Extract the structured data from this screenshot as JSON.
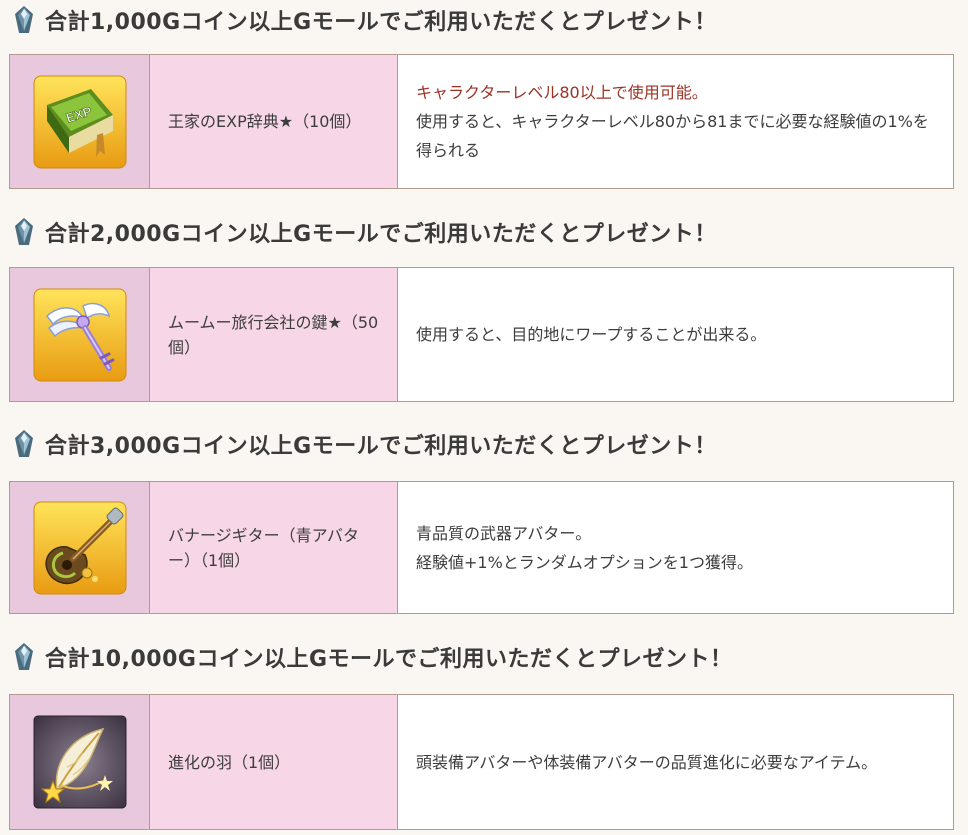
{
  "sections": [
    {
      "heading": "合計1,000Gコイン以上Gモールでご利用いただくとプレゼント！",
      "item_name": "王家のEXP辞典★（10個）",
      "icon": "exp-book-icon",
      "desc_requirement": "キャラクターレベル80以上で使用可能。",
      "desc_lines": [
        "使用すると、キャラクターレベル80から81までに必要な経験値の1%を得られる"
      ]
    },
    {
      "heading": "合計2,000Gコイン以上Gモールでご利用いただくとプレゼント！",
      "item_name": "ムームー旅行会社の鍵★（50個）",
      "icon": "winged-key-icon",
      "desc_lines": [
        "使用すると、目的地にワープすることが出来る。"
      ]
    },
    {
      "heading": "合計3,000Gコイン以上Gモールでご利用いただくとプレゼント！",
      "item_name": "バナージギター（青アバター）（1個）",
      "icon": "guitar-icon",
      "desc_lines": [
        "青品質の武器アバター。",
        "経験値+1%とランダムオプションを1つ獲得。"
      ]
    },
    {
      "heading": "合計10,000Gコイン以上Gモールでご利用いただくとプレゼント！",
      "item_name": "進化の羽（1個）",
      "icon": "feather-icon",
      "desc_lines": [
        "頭装備アバターや体装備アバターの品質進化に必要なアイテム。"
      ]
    }
  ],
  "colors": {
    "background": "#faf6f2",
    "icon_cell": "#e7c8dd",
    "name_cell": "#f7d7e7",
    "border": "#b39a8e",
    "requirement_text": "#9c3224"
  }
}
